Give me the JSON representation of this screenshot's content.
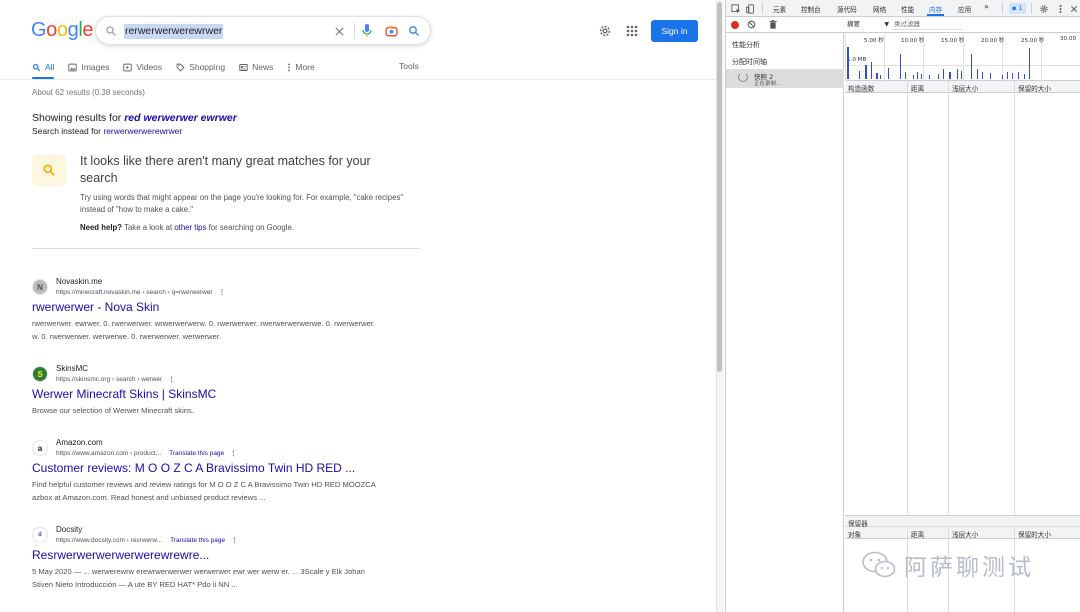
{
  "google": {
    "logo": [
      "G",
      "o",
      "o",
      "g",
      "l",
      "e"
    ],
    "search_query": "rerwerwerwerewrwer",
    "signin_label": "Sign in",
    "tabs": [
      {
        "label": "All",
        "icon": "search-icon",
        "active": true
      },
      {
        "label": "Images",
        "icon": "image-icon"
      },
      {
        "label": "Videos",
        "icon": "play-icon"
      },
      {
        "label": "Shopping",
        "icon": "tag-icon"
      },
      {
        "label": "News",
        "icon": "news-icon"
      },
      {
        "label": "More",
        "icon": "more-vert-icon"
      }
    ],
    "tools_label": "Tools",
    "stats": "About 62 results (0.38 seconds)",
    "showing_prefix": "Showing results for ",
    "showing_term": "red werwerwer ewrwer",
    "instead_prefix": "Search instead for ",
    "instead_term": "rerwerwerwerewrwer",
    "tip": {
      "title": "It looks like there aren't many great matches for your search",
      "body": "Try using words that might appear on the page you're looking for. For example, \"cake recipes\" instead of \"how to make a cake.\"",
      "help_bold": "Need help?",
      "help_mid": " Take a look at ",
      "help_link": "other tips",
      "help_end": " for searching on Google."
    },
    "results": [
      {
        "site": "Novaskin.me",
        "url": "https://minecraft.novaskin.me › search › q=rwerwerwer",
        "translate": "",
        "title": "rwerwerwer - Nova Skin",
        "snippet": "rwerwerwer. ewrwer. 0. rwerwerwer. wrwerwerwerw. 0. rwerwerwer. rwerwerwerwerwe. 0. rwerwerwer. w. 0. rwerwerwer. werwerwe. 0. rwerwerwer. werwerwer.",
        "fav": "N"
      },
      {
        "site": "SkinsMC",
        "url": "https://skinsmc.org › search › werwer",
        "translate": "",
        "title": "Werwer Minecraft Skins | SkinsMC",
        "snippet": "Browse our selection of Werwer Minecraft skins.",
        "fav": "S"
      },
      {
        "site": "Amazon.com",
        "url": "https://www.amazon.com › product...",
        "translate": "Translate this page",
        "title": "Customer reviews: M O O Z C A Bravissimo Twin HD RED ...",
        "snippet": "Find helpful customer reviews and review ratings for M O O Z C A Bravissimo Twin HD RED MOOZCA azbox at Amazon.com. Read honest and unbiased product reviews ...",
        "fav": "a"
      },
      {
        "site": "Docsity",
        "url": "https://www.docsity.com › resrwerw...",
        "translate": "Translate this page",
        "title": "Resrwerwerwerwerwerewrewre...",
        "snippet": "5 May 2020 — ... werwerewrw erewrwerwerwer werwerwer ewr wer werw er. ... 3Scale y Elk Johan Stiven Nieto Introducción — A ute BY RED HAT* Pdo ii NN ...",
        "fav": "d"
      }
    ]
  },
  "devtools": {
    "tabs": [
      "元素",
      "控制台",
      "源代码",
      "网络",
      "性能",
      "内存",
      "应用"
    ],
    "active_tab": "内存",
    "more": "»",
    "issues_badge": "1",
    "summary_select": "摘要",
    "class_filter": "类过滤器",
    "left_items": [
      "性能分析",
      "分配时间轴"
    ],
    "snapshot_title": "快照 2",
    "snapshot_sub": "正在录制...",
    "time_ticks": [
      "5.00 秒",
      "10.00 秒",
      "15.00 秒",
      "20.00 秒",
      "25.00 秒",
      "30.00"
    ],
    "mb_label": "1.0 MB",
    "columns": [
      "构造函数",
      "距离",
      "浅层大小",
      "保留的大小"
    ],
    "retainers_title": "保留器",
    "retainer_columns": [
      "对象",
      "距离",
      "浅层大小",
      "保留的大小"
    ],
    "allocation_bars": [
      {
        "t": 0.3,
        "v": 0.95
      },
      {
        "t": 1.8,
        "v": 0.25
      },
      {
        "t": 2.6,
        "v": 0.4
      },
      {
        "t": 3.3,
        "v": 0.5
      },
      {
        "t": 4.0,
        "v": 0.18
      },
      {
        "t": 4.5,
        "v": 0.12
      },
      {
        "t": 5.5,
        "v": 0.32
      },
      {
        "t": 7.0,
        "v": 0.75
      },
      {
        "t": 7.6,
        "v": 0.2
      },
      {
        "t": 8.6,
        "v": 0.12
      },
      {
        "t": 9.2,
        "v": 0.2
      },
      {
        "t": 9.7,
        "v": 0.15
      },
      {
        "t": 10.7,
        "v": 0.12
      },
      {
        "t": 11.8,
        "v": 0.15
      },
      {
        "t": 12.5,
        "v": 0.3
      },
      {
        "t": 13.3,
        "v": 0.2
      },
      {
        "t": 14.2,
        "v": 0.3
      },
      {
        "t": 14.8,
        "v": 0.25
      },
      {
        "t": 16.0,
        "v": 0.75
      },
      {
        "t": 16.8,
        "v": 0.3
      },
      {
        "t": 17.4,
        "v": 0.2
      },
      {
        "t": 18.5,
        "v": 0.18
      },
      {
        "t": 20.0,
        "v": 0.12
      },
      {
        "t": 20.6,
        "v": 0.2
      },
      {
        "t": 21.3,
        "v": 0.18
      },
      {
        "t": 22.0,
        "v": 0.2
      },
      {
        "t": 22.8,
        "v": 0.15
      },
      {
        "t": 23.4,
        "v": 0.9
      }
    ]
  },
  "watermark": "阿萨聊测试",
  "colors": {
    "link": "#1a0dab",
    "accent": "#1a73e8",
    "record": "#d93025",
    "bar": "#2f50c9"
  }
}
